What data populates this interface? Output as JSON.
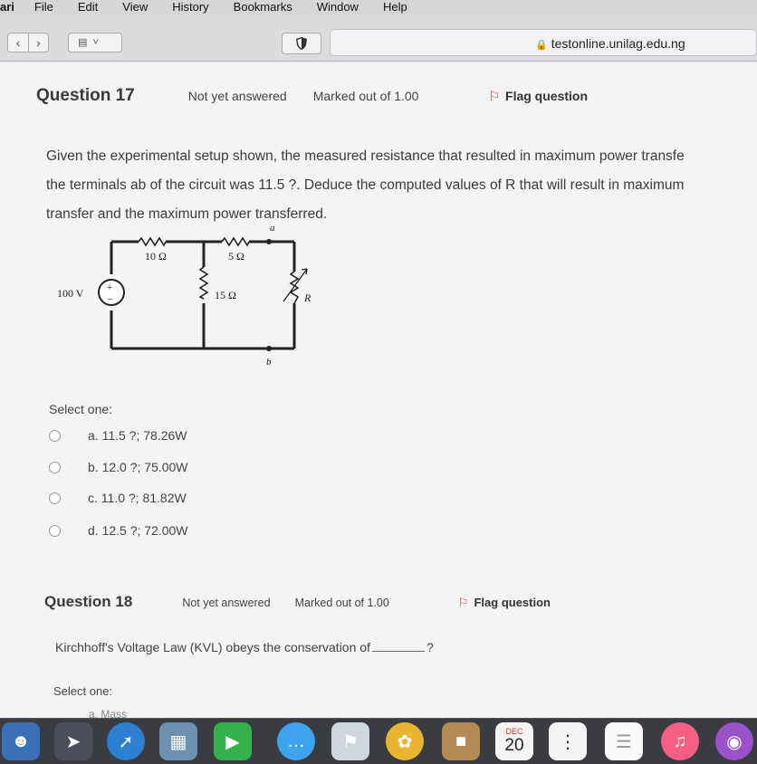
{
  "menubar": {
    "items": [
      "ari",
      "File",
      "Edit",
      "View",
      "History",
      "Bookmarks",
      "Window",
      "Help"
    ]
  },
  "browser": {
    "back_icon": "chevron-left-icon",
    "forward_icon": "chevron-right-icon",
    "url": "testonline.unilag.edu.ng"
  },
  "question17": {
    "title": "Question 17",
    "status": "Not yet answered",
    "marks": "Marked out of 1.00",
    "flag": "Flag question",
    "text_lines": [
      "Given the experimental setup shown, the measured resistance that resulted in maximum power transfe",
      "the terminals ab of the circuit was 11.5 ?. Deduce the computed values of R that will result in maximum",
      "transfer and the maximum power transferred."
    ],
    "circuit": {
      "source": "100 V",
      "r1": "10 Ω",
      "r2": "5 Ω",
      "r3": "15 Ω",
      "load": "R",
      "node_a": "a",
      "node_b": "b"
    },
    "select_label": "Select one:",
    "options": [
      "a. 11.5 ?; 78.26W",
      "b. 12.0 ?; 75.00W",
      "c. 11.0 ?; 81.82W",
      "d. 12.5 ?; 72.00W"
    ]
  },
  "question18": {
    "title": "Question 18",
    "status": "Not yet answered",
    "marks": "Marked out of 1.00",
    "flag": "Flag question",
    "text_before": "Kirchhoff's Voltage Law (KVL) obeys the conservation of",
    "text_after": "?",
    "select_label": "Select one:",
    "first_option": "a. Mass"
  },
  "dock": {
    "calendar_month": "DEC",
    "calendar_day": "20"
  }
}
